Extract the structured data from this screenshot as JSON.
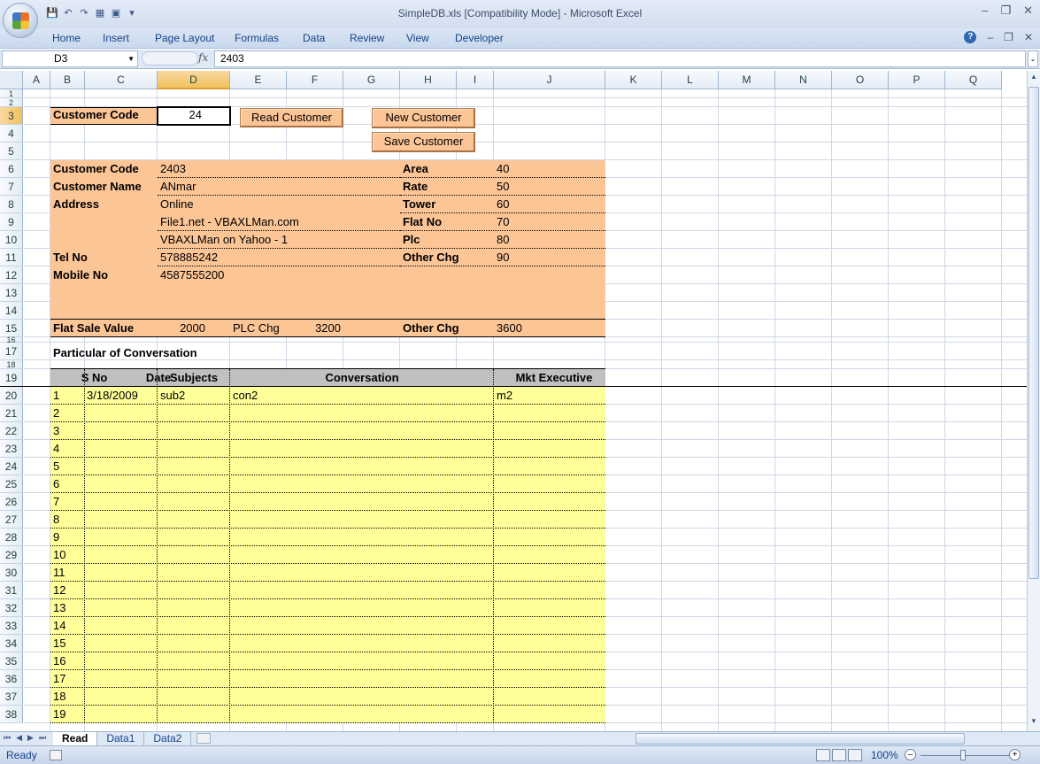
{
  "window": {
    "title": "SimpleDB.xls  [Compatibility Mode] - Microsoft Excel"
  },
  "ribbon": {
    "tabs": [
      "Home",
      "Insert",
      "Page Layout",
      "Formulas",
      "Data",
      "Review",
      "View",
      "Developer"
    ]
  },
  "formula_bar": {
    "name_box": "D3",
    "fx": "fx",
    "value": "2403"
  },
  "columns": [
    "A",
    "B",
    "C",
    "D",
    "E",
    "F",
    "G",
    "H",
    "I",
    "J",
    "K",
    "L",
    "M",
    "N",
    "O",
    "P",
    "Q"
  ],
  "rows": [
    "1",
    "2",
    "3",
    "4",
    "5",
    "6",
    "7",
    "8",
    "9",
    "10",
    "11",
    "12",
    "13",
    "14",
    "15",
    "16",
    "17",
    "18",
    "19",
    "20",
    "21",
    "22",
    "23",
    "24",
    "25",
    "26",
    "27",
    "28",
    "29",
    "30",
    "31",
    "32",
    "33",
    "34",
    "35",
    "36",
    "37",
    "38"
  ],
  "form": {
    "customer_code_label": "Customer Code",
    "customer_code_value": "24",
    "read_button": "Read Customer",
    "new_button": "New Customer",
    "save_button": "Save Customer"
  },
  "details": {
    "left": [
      {
        "label": "Customer Code",
        "value": "2403"
      },
      {
        "label": "Customer Name",
        "value": "ANmar"
      },
      {
        "label": "Address",
        "value": "Online"
      },
      {
        "label": "",
        "value": "File1.net - VBAXLMan.com"
      },
      {
        "label": "",
        "value": "VBAXLMan on Yahoo - 1"
      },
      {
        "label": "Tel No",
        "value": "578885242"
      },
      {
        "label": "Mobile No",
        "value": "4587555200"
      }
    ],
    "right": [
      {
        "label": "Area",
        "value": "40"
      },
      {
        "label": "Rate",
        "value": "50"
      },
      {
        "label": "Tower",
        "value": "60"
      },
      {
        "label": "Flat No",
        "value": "70"
      },
      {
        "label": "Plc",
        "value": "80"
      },
      {
        "label": "Other Chg",
        "value": "90"
      }
    ],
    "summary": {
      "flat_sale_label": "Flat Sale Value",
      "flat_sale_value": "2000",
      "plc_label": "PLC Chg",
      "plc_value": "3200",
      "other_label": "Other Chg",
      "other_value": "3600"
    }
  },
  "conversation": {
    "title": "Particular of Conversation",
    "headers": {
      "sno": "S No",
      "date": "Date",
      "subjects": "Subjects",
      "conversation": "Conversation",
      "executive": "Mkt Executive"
    },
    "rows": [
      {
        "sno": "1",
        "date": "3/18/2009",
        "subject": "sub2",
        "conversation": "con2",
        "executive": "m2"
      },
      {
        "sno": "2",
        "date": "",
        "subject": "",
        "conversation": "",
        "executive": ""
      },
      {
        "sno": "3",
        "date": "",
        "subject": "",
        "conversation": "",
        "executive": ""
      },
      {
        "sno": "4",
        "date": "",
        "subject": "",
        "conversation": "",
        "executive": ""
      },
      {
        "sno": "5",
        "date": "",
        "subject": "",
        "conversation": "",
        "executive": ""
      },
      {
        "sno": "6",
        "date": "",
        "subject": "",
        "conversation": "",
        "executive": ""
      },
      {
        "sno": "7",
        "date": "",
        "subject": "",
        "conversation": "",
        "executive": ""
      },
      {
        "sno": "8",
        "date": "",
        "subject": "",
        "conversation": "",
        "executive": ""
      },
      {
        "sno": "9",
        "date": "",
        "subject": "",
        "conversation": "",
        "executive": ""
      },
      {
        "sno": "10",
        "date": "",
        "subject": "",
        "conversation": "",
        "executive": ""
      },
      {
        "sno": "11",
        "date": "",
        "subject": "",
        "conversation": "",
        "executive": ""
      },
      {
        "sno": "12",
        "date": "",
        "subject": "",
        "conversation": "",
        "executive": ""
      },
      {
        "sno": "13",
        "date": "",
        "subject": "",
        "conversation": "",
        "executive": ""
      },
      {
        "sno": "14",
        "date": "",
        "subject": "",
        "conversation": "",
        "executive": ""
      },
      {
        "sno": "15",
        "date": "",
        "subject": "",
        "conversation": "",
        "executive": ""
      },
      {
        "sno": "16",
        "date": "",
        "subject": "",
        "conversation": "",
        "executive": ""
      },
      {
        "sno": "17",
        "date": "",
        "subject": "",
        "conversation": "",
        "executive": ""
      },
      {
        "sno": "18",
        "date": "",
        "subject": "",
        "conversation": "",
        "executive": ""
      },
      {
        "sno": "19",
        "date": "",
        "subject": "",
        "conversation": "",
        "executive": ""
      }
    ]
  },
  "sheets": {
    "tabs": [
      "Read",
      "Data1",
      "Data2"
    ],
    "active": "Read"
  },
  "status": {
    "text": "Ready",
    "zoom": "100%"
  },
  "colors": {
    "orange_fill": "#fcc596",
    "yellow_fill": "#ffff99",
    "header_gray": "#c0c0c0",
    "ribbon_blue": "#15428b"
  }
}
